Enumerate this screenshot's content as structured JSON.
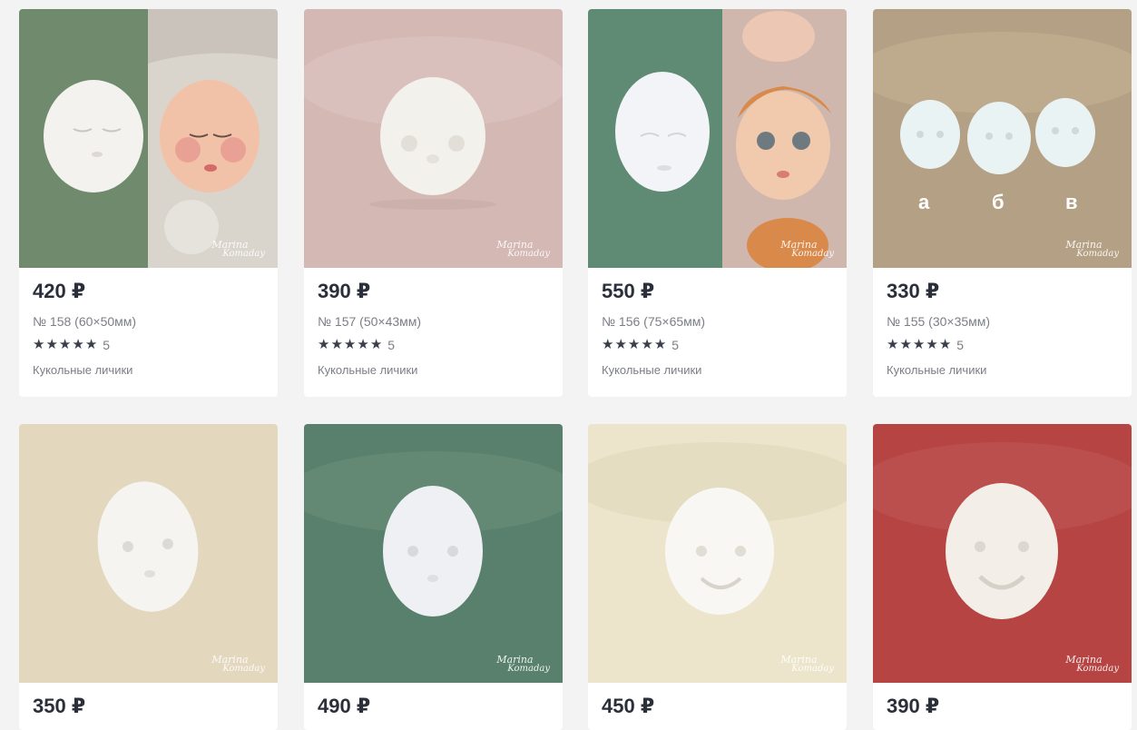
{
  "watermark": {
    "line1": "Marina",
    "line2": "Komaday"
  },
  "products": [
    {
      "price": "420 ₽",
      "title": "№ 158 (60×50мм)",
      "rating_count": "5",
      "category": "Кукольные личики",
      "bg": "#6f8a6c",
      "photo": "sleeping-baby-face"
    },
    {
      "price": "390 ₽",
      "title": "№ 157 (50×43мм)",
      "rating_count": "5",
      "category": "Кукольные личики",
      "bg": "#d4b8b4",
      "photo": "round-baby-face"
    },
    {
      "price": "550 ₽",
      "title": "№ 156 (75×65мм)",
      "rating_count": "5",
      "category": "Кукольные личики",
      "bg": "#5f8b74",
      "photo": "baby-face-painted"
    },
    {
      "price": "330 ₽",
      "title": "№ 155 (30×35мм)",
      "rating_count": "5",
      "category": "Кукольные личики",
      "bg": "#b4a084",
      "photo": "three-small-faces",
      "variants": [
        "а",
        "б",
        "в"
      ]
    },
    {
      "price": "350 ₽",
      "bg": "#e3d7be",
      "photo": "baby-face"
    },
    {
      "price": "490 ₽",
      "bg": "#58806c",
      "photo": "baby-face"
    },
    {
      "price": "450 ₽",
      "bg": "#ece5cb",
      "photo": "smiling-face"
    },
    {
      "price": "390 ₽",
      "bg": "#b54443",
      "photo": "smiling-face"
    }
  ]
}
